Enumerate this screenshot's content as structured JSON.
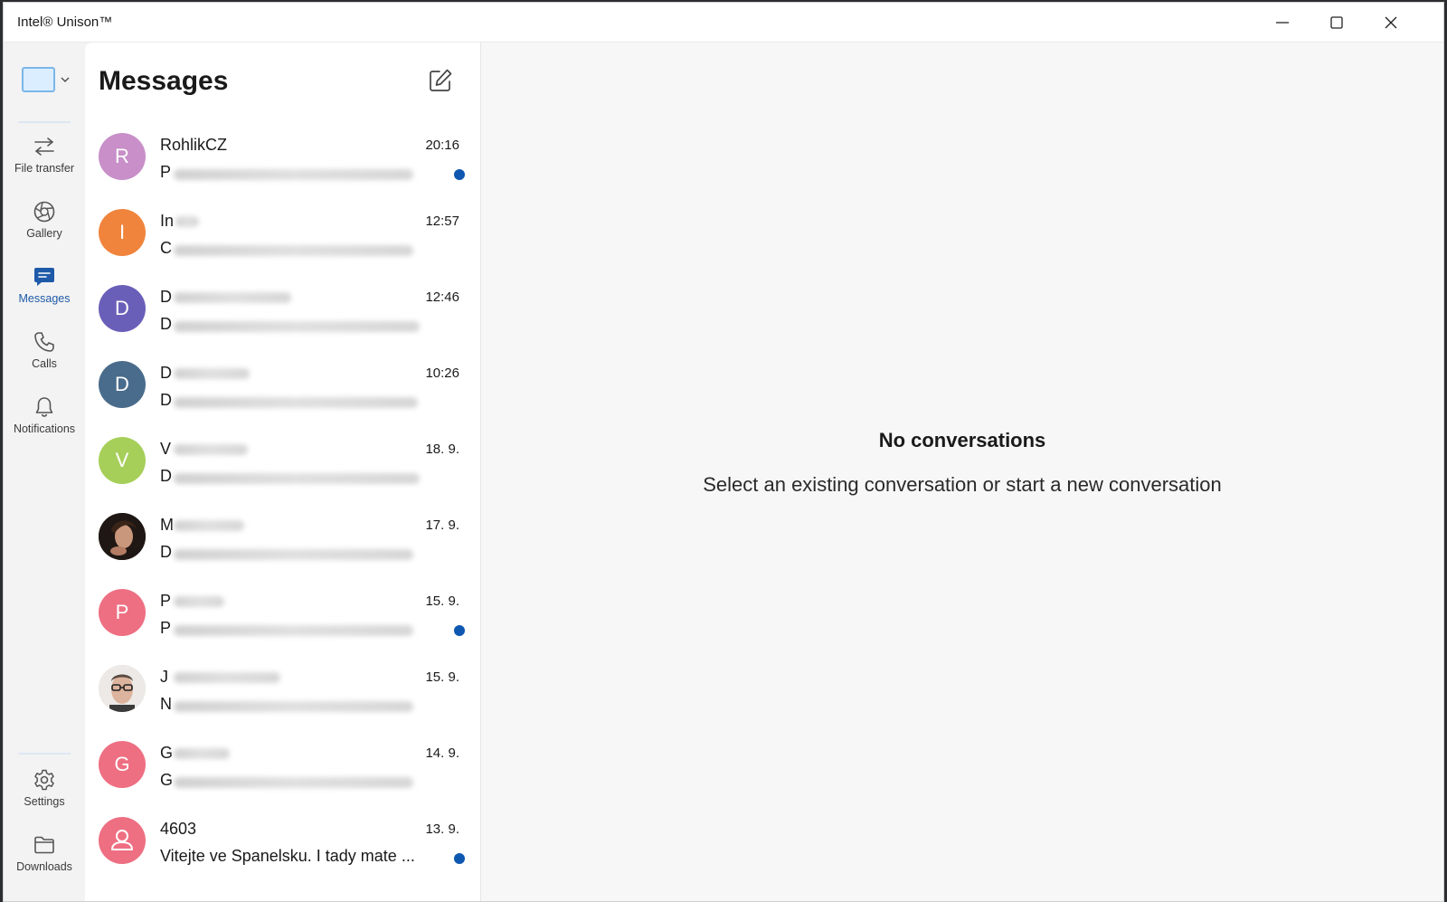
{
  "window": {
    "title": "Intel® Unison™",
    "controls": [
      "minimize-icon",
      "maximize-icon",
      "close-icon"
    ]
  },
  "nav": {
    "device_selector_icon": "laptop-icon",
    "items": [
      {
        "label": "File transfer",
        "icon": "transfer-arrows-icon",
        "active": false
      },
      {
        "label": "Gallery",
        "icon": "aperture-icon",
        "active": false
      },
      {
        "label": "Messages",
        "icon": "chat-bubble-icon",
        "active": true
      },
      {
        "label": "Calls",
        "icon": "phone-icon",
        "active": false
      },
      {
        "label": "Notifications",
        "icon": "bell-icon",
        "active": false
      }
    ],
    "bottom_items": [
      {
        "label": "Settings",
        "icon": "gear-icon"
      },
      {
        "label": "Downloads",
        "icon": "folder-icon"
      }
    ]
  },
  "messages": {
    "title": "Messages",
    "compose_icon": "compose-icon",
    "conversations": [
      {
        "initial": "R",
        "name": "RohlikCZ",
        "time": "20:16",
        "preview": "P",
        "unread": true,
        "avatar_color": "#c88fc8"
      },
      {
        "initial": "I",
        "name": "In",
        "time": "12:57",
        "preview": "C",
        "unread": false,
        "avatar_color": "#f0843c"
      },
      {
        "initial": "D",
        "name": "D",
        "time": "12:46",
        "preview": "D",
        "unread": false,
        "avatar_color": "#6a5fb8"
      },
      {
        "initial": "D",
        "name": "D",
        "time": "10:26",
        "preview": "D",
        "unread": false,
        "avatar_color": "#4a6c8c"
      },
      {
        "initial": "V",
        "name": "V",
        "time": "18. 9.",
        "preview": "D",
        "unread": false,
        "avatar_color": "#a6cf5a"
      },
      {
        "initial": "",
        "name": "M",
        "time": "17. 9.",
        "preview": "D",
        "unread": false,
        "avatar_color": "#2a1f1c"
      },
      {
        "initial": "P",
        "name": "P",
        "time": "15. 9.",
        "preview": "P",
        "unread": true,
        "avatar_color": "#ee6f82"
      },
      {
        "initial": "",
        "name": "J",
        "time": "15. 9.",
        "preview": "N",
        "unread": false,
        "avatar_color": "#d9d3cf"
      },
      {
        "initial": "G",
        "name": "G",
        "time": "14. 9.",
        "preview": "G",
        "unread": false,
        "avatar_color": "#ee6f82"
      },
      {
        "initial": "",
        "name": "4603",
        "time": "13. 9.",
        "preview": "Vitejte ve Spanelsku. I tady mate ...",
        "unread": true,
        "avatar_color": "#ee6f82"
      }
    ]
  },
  "empty_state": {
    "title": "No conversations",
    "subtitle": "Select an existing conversation or start a new conversation"
  },
  "colors": {
    "accent": "#1e5aa8",
    "unread_dot": "#0d57b0"
  }
}
